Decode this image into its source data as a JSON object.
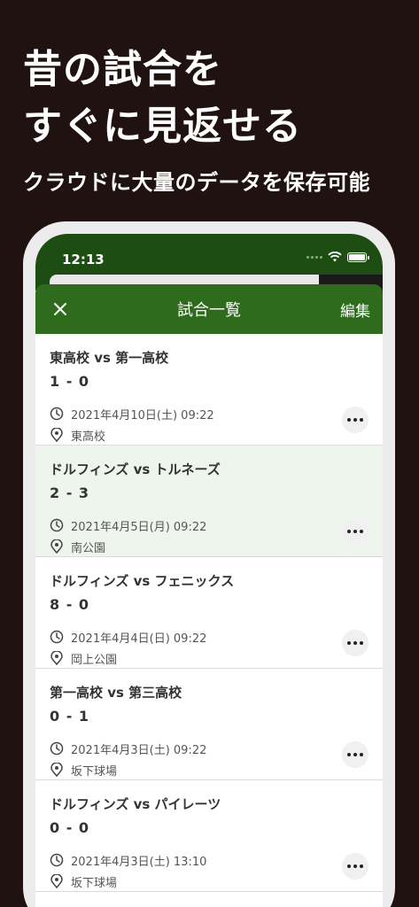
{
  "headline": {
    "line1": "昔の試合を",
    "line2": "すぐに見返せる"
  },
  "subhead": "クラウドに大量のデータを保存可能",
  "status": {
    "time": "12:13"
  },
  "nav": {
    "title": "試合一覧",
    "edit_label": "編集"
  },
  "matches": [
    {
      "title": "東高校 vs 第一高校",
      "score": "1 - 0",
      "date": "2021年4月10日(土) 09:22",
      "place": "東高校"
    },
    {
      "title": "ドルフィンズ vs トルネーズ",
      "score": "2 - 3",
      "date": "2021年4月5日(月) 09:22",
      "place": "南公園"
    },
    {
      "title": "ドルフィンズ vs フェニックス",
      "score": "8 - 0",
      "date": "2021年4月4日(日) 09:22",
      "place": "岡上公園"
    },
    {
      "title": "第一高校 vs 第三高校",
      "score": "0 - 1",
      "date": "2021年4月3日(土) 09:22",
      "place": "坂下球場"
    },
    {
      "title": "ドルフィンズ vs パイレーツ",
      "score": "0 - 0",
      "date": "2021年4月3日(土) 13:10",
      "place": "坂下球場"
    }
  ],
  "colors": {
    "background": "#1f1210",
    "header_green": "#2f6b1c",
    "status_green": "#1e4d14",
    "highlight_row": "#eef5ec"
  },
  "icons": {
    "close": "close-icon",
    "clock": "clock-icon",
    "location": "location-icon",
    "more": "more-icon",
    "wifi": "wifi-icon",
    "battery": "battery-icon"
  }
}
